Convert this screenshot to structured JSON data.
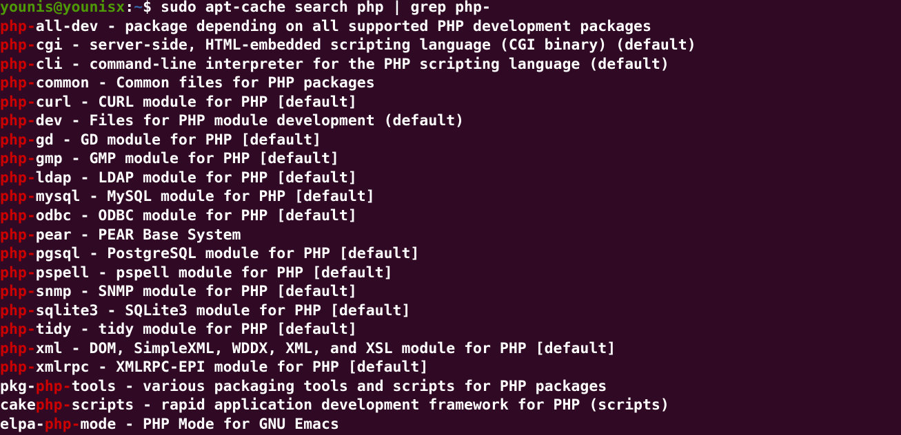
{
  "terminal": {
    "window_title": "younis@younisx: ~",
    "background_color": "#300a24",
    "foreground_color": "#ffffff",
    "prompt_color": "#4e9a06",
    "path_color": "#3465a4",
    "match_highlight_color": "#cc0000",
    "columns": 78,
    "rows": 23,
    "prompt": {
      "user_host": "younis@younisx",
      "colon": ":",
      "path": "~",
      "sigil": "$",
      "space": " "
    },
    "command": "sudo apt-cache search php | grep php-",
    "lines": [
      {
        "id": "prompt-line",
        "segments": [
          {
            "text": "younis@younisx",
            "color": "green"
          },
          {
            "text": ":",
            "color": "white"
          },
          {
            "text": "~",
            "color": "blue"
          },
          {
            "text": "$ ",
            "color": "white"
          },
          {
            "text": "sudo apt-cache search php | grep php-",
            "color": "white"
          }
        ]
      },
      {
        "id": "result-php-all-dev",
        "segments": [
          {
            "text": "php-",
            "color": "red"
          },
          {
            "text": "all-dev - package depending on all supported PHP development packages",
            "color": "white"
          }
        ]
      },
      {
        "id": "result-php-cgi",
        "segments": [
          {
            "text": "php-",
            "color": "red"
          },
          {
            "text": "cgi - server-side, HTML-embedded scripting language (CGI binary) (default)",
            "color": "white"
          }
        ]
      },
      {
        "id": "result-php-cli",
        "segments": [
          {
            "text": "php-",
            "color": "red"
          },
          {
            "text": "cli - command-line interpreter for the PHP scripting language (default)",
            "color": "white"
          }
        ]
      },
      {
        "id": "result-php-common",
        "segments": [
          {
            "text": "php-",
            "color": "red"
          },
          {
            "text": "common - Common files for PHP packages",
            "color": "white"
          }
        ]
      },
      {
        "id": "result-php-curl",
        "segments": [
          {
            "text": "php-",
            "color": "red"
          },
          {
            "text": "curl - CURL module for PHP [default]",
            "color": "white"
          }
        ]
      },
      {
        "id": "result-php-dev",
        "segments": [
          {
            "text": "php-",
            "color": "red"
          },
          {
            "text": "dev - Files for PHP module development (default)",
            "color": "white"
          }
        ]
      },
      {
        "id": "result-php-gd",
        "segments": [
          {
            "text": "php-",
            "color": "red"
          },
          {
            "text": "gd - GD module for PHP [default]",
            "color": "white"
          }
        ]
      },
      {
        "id": "result-php-gmp",
        "segments": [
          {
            "text": "php-",
            "color": "red"
          },
          {
            "text": "gmp - GMP module for PHP [default]",
            "color": "white"
          }
        ]
      },
      {
        "id": "result-php-ldap",
        "segments": [
          {
            "text": "php-",
            "color": "red"
          },
          {
            "text": "ldap - LDAP module for PHP [default]",
            "color": "white"
          }
        ]
      },
      {
        "id": "result-php-mysql",
        "segments": [
          {
            "text": "php-",
            "color": "red"
          },
          {
            "text": "mysql - MySQL module for PHP [default]",
            "color": "white"
          }
        ]
      },
      {
        "id": "result-php-odbc",
        "segments": [
          {
            "text": "php-",
            "color": "red"
          },
          {
            "text": "odbc - ODBC module for PHP [default]",
            "color": "white"
          }
        ]
      },
      {
        "id": "result-php-pear",
        "segments": [
          {
            "text": "php-",
            "color": "red"
          },
          {
            "text": "pear - PEAR Base System",
            "color": "white"
          }
        ]
      },
      {
        "id": "result-php-pgsql",
        "segments": [
          {
            "text": "php-",
            "color": "red"
          },
          {
            "text": "pgsql - PostgreSQL module for PHP [default]",
            "color": "white"
          }
        ]
      },
      {
        "id": "result-php-pspell",
        "segments": [
          {
            "text": "php-",
            "color": "red"
          },
          {
            "text": "pspell - pspell module for PHP [default]",
            "color": "white"
          }
        ]
      },
      {
        "id": "result-php-snmp",
        "segments": [
          {
            "text": "php-",
            "color": "red"
          },
          {
            "text": "snmp - SNMP module for PHP [default]",
            "color": "white"
          }
        ]
      },
      {
        "id": "result-php-sqlite3",
        "segments": [
          {
            "text": "php-",
            "color": "red"
          },
          {
            "text": "sqlite3 - SQLite3 module for PHP [default]",
            "color": "white"
          }
        ]
      },
      {
        "id": "result-php-tidy",
        "segments": [
          {
            "text": "php-",
            "color": "red"
          },
          {
            "text": "tidy - tidy module for PHP [default]",
            "color": "white"
          }
        ]
      },
      {
        "id": "result-php-xml",
        "segments": [
          {
            "text": "php-",
            "color": "red"
          },
          {
            "text": "xml - DOM, SimpleXML, WDDX, XML, and XSL module for PHP [default]",
            "color": "white"
          }
        ]
      },
      {
        "id": "result-php-xmlrpc",
        "segments": [
          {
            "text": "php-",
            "color": "red"
          },
          {
            "text": "xmlrpc - XMLRPC-EPI module for PHP [default]",
            "color": "white"
          }
        ]
      },
      {
        "id": "result-pkg-php-tools",
        "segments": [
          {
            "text": "pkg-",
            "color": "white"
          },
          {
            "text": "php-",
            "color": "red"
          },
          {
            "text": "tools - various packaging tools and scripts for PHP packages",
            "color": "white"
          }
        ]
      },
      {
        "id": "result-cakephp-scripts",
        "segments": [
          {
            "text": "cake",
            "color": "white"
          },
          {
            "text": "php-",
            "color": "red"
          },
          {
            "text": "scripts - rapid application development framework for PHP (scripts)",
            "color": "white"
          }
        ]
      },
      {
        "id": "result-elpa-php-mode",
        "segments": [
          {
            "text": "elpa-",
            "color": "white"
          },
          {
            "text": "php-",
            "color": "red"
          },
          {
            "text": "mode - PHP Mode for GNU Emacs",
            "color": "white"
          }
        ]
      }
    ]
  }
}
